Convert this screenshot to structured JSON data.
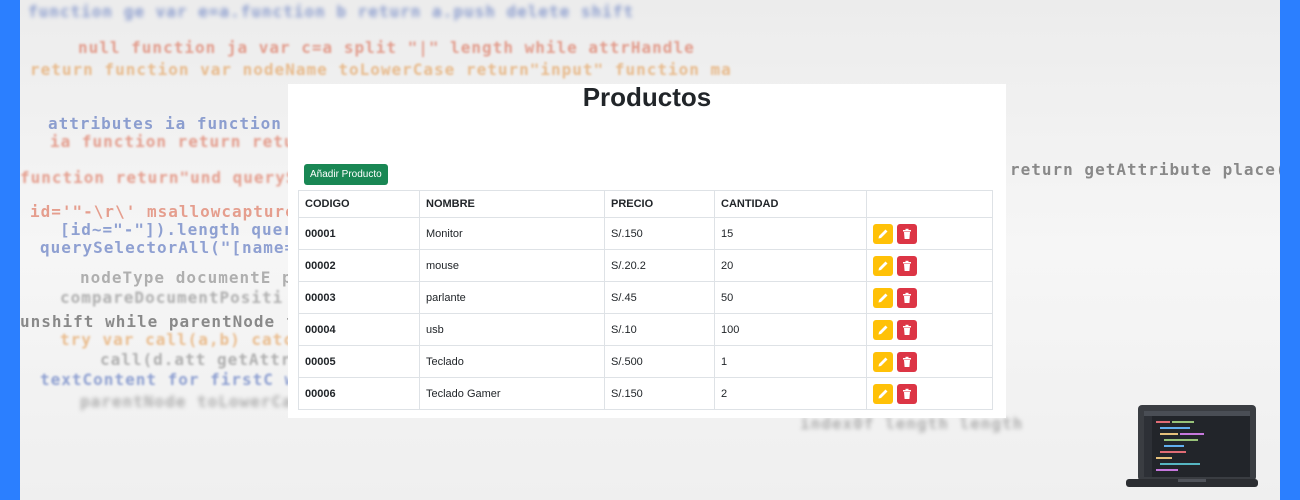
{
  "page": {
    "title": "Productos"
  },
  "toolbar": {
    "add_label": "Añadir Producto"
  },
  "table": {
    "columns": [
      "CODIGO",
      "NOMBRE",
      "PRECIO",
      "CANTIDAD",
      ""
    ],
    "rows": [
      {
        "code": "00001",
        "name": "Monitor",
        "price": "S/.150",
        "qty": "15"
      },
      {
        "code": "00002",
        "name": "mouse",
        "price": "S/.20.2",
        "qty": "20"
      },
      {
        "code": "00003",
        "name": "parlante",
        "price": "S/.45",
        "qty": "50"
      },
      {
        "code": "00004",
        "name": "usb",
        "price": "S/.10",
        "qty": "100"
      },
      {
        "code": "00005",
        "name": "Teclado",
        "price": "S/.500",
        "qty": "1"
      },
      {
        "code": "00006",
        "name": "Teclado Gamer",
        "price": "S/.150",
        "qty": "2"
      }
    ]
  },
  "icons": {
    "edit": "pencil-icon",
    "delete": "trash-icon",
    "decor": "laptop-icon"
  },
  "colors": {
    "accent_bar": "#2b7fff",
    "add": "#198754",
    "edit": "#ffc107",
    "delete": "#dc3545"
  },
  "background_code": [
    "function ge  var e=a.function b  return a.push  delete  shift",
    "null  function ja  var c=a split \"|\" length while  attrHandle",
    "return function  var  nodeName toLowerCase  return\"input\"  function ma",
    "attributes ia function  setDocument  ownerDocument",
    "ia function return  return  getAttribute  length",
    "return getAttribute  place(ba,ca) return function",
    "function return\"und  querySelectorAll",
    "id='\"-\\r\\' msallowcapture  rAll(\"[msallowcapture^='']",
    "[id~=\"-\"]).length  querySelectorAll  length push",
    "querySelectorAll(\"[name=  bled\").length  push",
    "nodeType  documentE  push(\"!=\"  contains",
    "compareDocumentPositi  ownerDocument  compare",
    "unshift  while  parentNode  function(a,b) return fa",
    "try var  call(a,b)  catch(e) return fa",
    "call(d.att  getAttribute  push",
    "textContent for  firstC  while  return",
    "parentNode  toLowerCase  return",
    "index0f  length  length"
  ]
}
